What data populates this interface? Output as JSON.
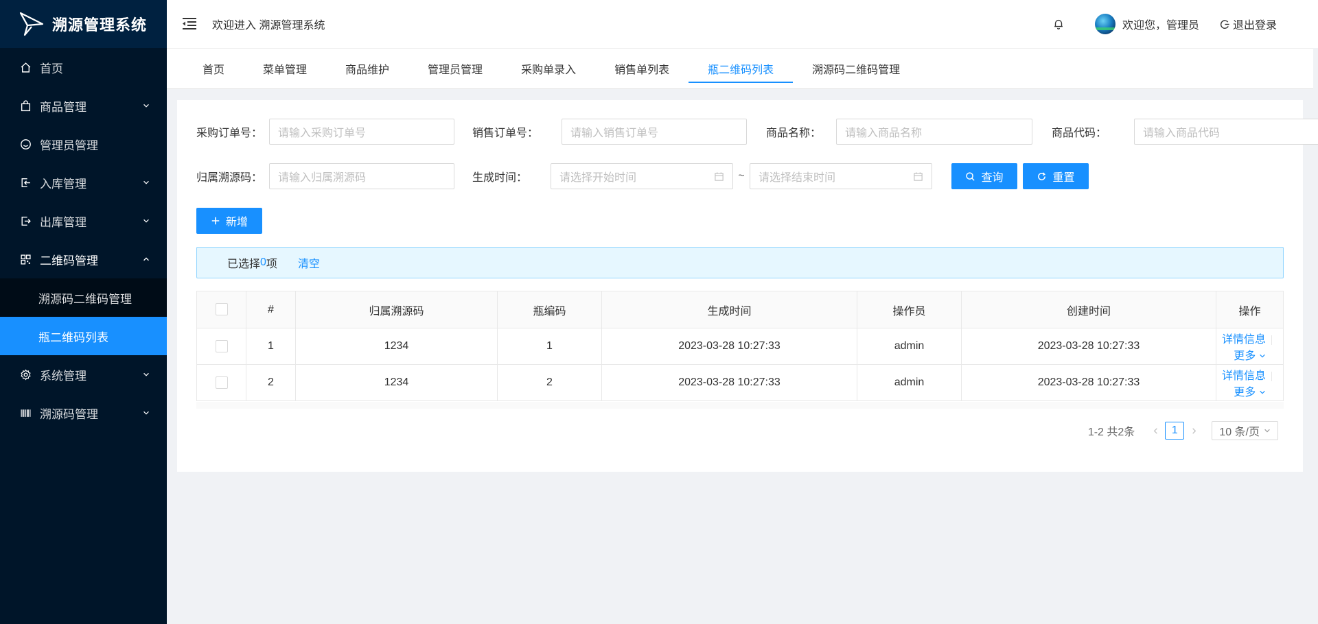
{
  "app": {
    "title": "溯源管理系统"
  },
  "sidebar": {
    "items": [
      {
        "label": "首页",
        "icon": "home-icon"
      },
      {
        "label": "商品管理",
        "icon": "bag-icon"
      },
      {
        "label": "管理员管理",
        "icon": "smile-icon"
      },
      {
        "label": "入库管理",
        "icon": "import-icon"
      },
      {
        "label": "出库管理",
        "icon": "export-icon"
      },
      {
        "label": "二维码管理",
        "icon": "qrcode-icon"
      },
      {
        "label": "系统管理",
        "icon": "gear-icon"
      },
      {
        "label": "溯源码管理",
        "icon": "barcode-icon"
      }
    ],
    "submenu": [
      {
        "label": "溯源码二维码管理"
      },
      {
        "label": "瓶二维码列表"
      }
    ]
  },
  "header": {
    "welcome": "欢迎进入 溯源管理系统",
    "user": "欢迎您，管理员",
    "logout": "退出登录"
  },
  "tabs": [
    "首页",
    "菜单管理",
    "商品维护",
    "管理员管理",
    "采购单录入",
    "销售单列表",
    "瓶二维码列表",
    "溯源码二维码管理"
  ],
  "form": {
    "purchase_label": "采购订单号：",
    "purchase_ph": "请输入采购订单号",
    "sales_label": "销售订单号：",
    "sales_ph": "请输入销售订单号",
    "name_label": "商品名称：",
    "name_ph": "请输入商品名称",
    "code_label": "商品代码：",
    "code_ph": "请输入商品代码",
    "trace_label": "归属溯源码：",
    "trace_ph": "请输入归属溯源码",
    "time_label": "生成时间：",
    "start_ph": "请选择开始时间",
    "tilde": "~",
    "end_ph": "请选择结束时间",
    "query": "查询",
    "reset": "重置",
    "add": "新增"
  },
  "alert": {
    "prefix": "已选择 ",
    "count": "0",
    "suffix": "项",
    "clear": "清空"
  },
  "table": {
    "headers": [
      "#",
      "归属溯源码",
      "瓶编码",
      "生成时间",
      "操作员",
      "创建时间",
      "操作"
    ],
    "rows": [
      {
        "idx": "1",
        "trace": "1234",
        "bottle": "1",
        "gen_time": "2023-03-28 10:27:33",
        "operator": "admin",
        "create_time": "2023-03-28 10:27:33"
      },
      {
        "idx": "2",
        "trace": "1234",
        "bottle": "2",
        "gen_time": "2023-03-28 10:27:33",
        "operator": "admin",
        "create_time": "2023-03-28 10:27:33"
      }
    ],
    "op_detail": "详情信息",
    "op_more": "更多"
  },
  "pager": {
    "total": "1-2 共2条",
    "page": "1",
    "size": "10 条/页"
  },
  "colors": {
    "primary": "#1890ff",
    "sidebar": "#001529"
  }
}
